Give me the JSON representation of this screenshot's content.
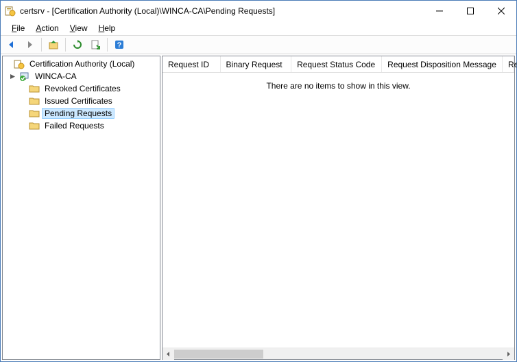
{
  "title": "certsrv - [Certification Authority (Local)\\WINCA-CA\\Pending Requests]",
  "menu": {
    "file": "File",
    "action": "Action",
    "view": "View",
    "help": "Help"
  },
  "tree": {
    "root": "Certification Authority (Local)",
    "ca": "WINCA-CA",
    "revoked": "Revoked Certificates",
    "issued": "Issued Certificates",
    "pending": "Pending Requests",
    "failed": "Failed Requests"
  },
  "columns": {
    "requestId": "Request ID",
    "binaryRequest": "Binary Request",
    "statusCode": "Request Status Code",
    "dispMsg": "Request Disposition Message",
    "requester": "Request"
  },
  "empty_message": "There are no items to show in this view."
}
